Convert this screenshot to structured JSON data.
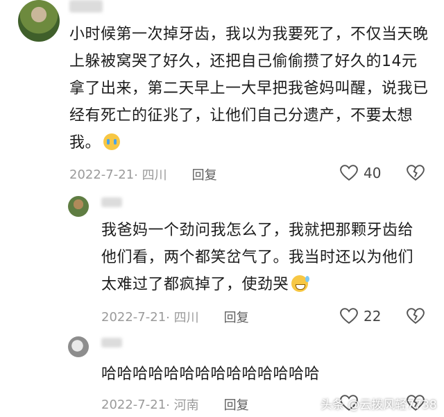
{
  "comments": [
    {
      "text": "小时候第一次掉牙齿，我以为我要死了，不仅当天晚上躲被窝哭了好久，还把自己偷偷攒了好久的14元拿了出来，第二天早上一大早把我爸妈叫醒，说我已经有死亡的征兆了，让他们自己分遗产，不要太想我。",
      "emoji": "crying-face-emoji",
      "date": "2022-7-21",
      "location": "· 四川",
      "reply_label": "回复",
      "likes": "40"
    },
    {
      "text": "我爸妈一个劲问我怎么了，我就把那颗牙齿给他们看，两个都笑岔气了。我当时还以为他们太难过了都疯掉了，使劲哭",
      "emoji": "grinning-sweat-emoji",
      "date": "2022-7-21",
      "location": "· 四川",
      "reply_label": "回复",
      "likes": "22"
    },
    {
      "text": "哈哈哈哈哈哈哈哈哈哈哈哈哈哈",
      "date": "2022-7-21",
      "location": "· 河南",
      "reply_label": "回复",
      "likes": ""
    }
  ],
  "watermark": "头条 @云拨风轻7738",
  "colors": {
    "meta": "#9a9a9a",
    "text": "#1b1b1b",
    "background": "#ffffff"
  },
  "icons": {
    "like": "heart-outline-icon",
    "dislike": "broken-heart-icon"
  }
}
